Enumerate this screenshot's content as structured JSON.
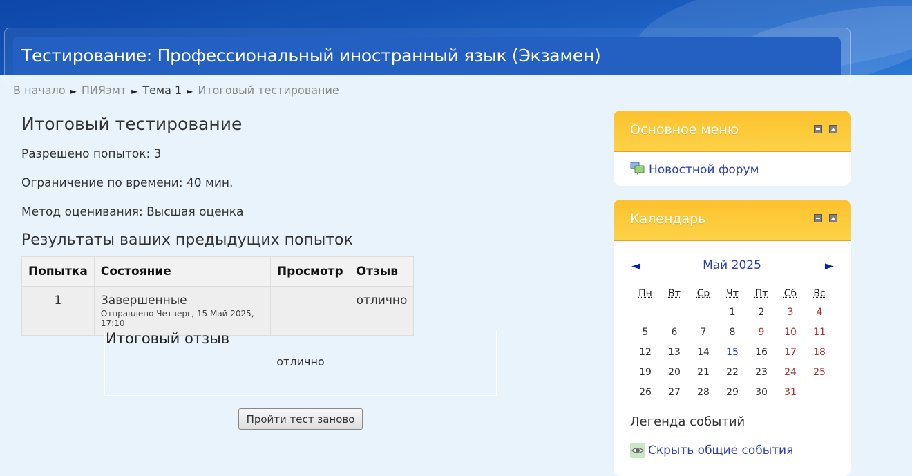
{
  "header": {
    "title": "Тестирование: Профессиональный иностранный язык (Экзамен)"
  },
  "breadcrumb": {
    "items": [
      "В начало",
      "ПИЯэмт",
      "Тема 1",
      "Итоговый тестирование"
    ]
  },
  "quiz": {
    "title": "Итоговый тестирование",
    "attempts_allowed": "Разрешено попыток: 3",
    "time_limit": "Ограничение по времени: 40 мин.",
    "grading_method": "Метод оценивания: Высшая оценка"
  },
  "results": {
    "heading": "Результаты ваших предыдущих попыток",
    "columns": [
      "Попытка",
      "Состояние",
      "Просмотр",
      "Отзыв"
    ],
    "rows": [
      {
        "attempt": "1",
        "state": "Завершенные",
        "state_detail": "Отправлено Четверг, 15 Май 2025, 17:10",
        "review": "",
        "feedback": "отлично"
      }
    ]
  },
  "overall_feedback": {
    "title": "Итоговый отзыв",
    "text": "отлично"
  },
  "retry_button_label": "Пройти тест заново",
  "main_menu": {
    "title": "Основное меню",
    "forum_link": "Новостной форум"
  },
  "calendar": {
    "title": "Календарь",
    "prev": "◄",
    "next": "►",
    "month": "Май 2025",
    "weekdays": [
      "Пн",
      "Вт",
      "Ср",
      "Чт",
      "Пт",
      "Сб",
      "Вс"
    ],
    "weeks": [
      [
        "",
        "",
        "",
        "1",
        "2",
        "3",
        "4"
      ],
      [
        "5",
        "6",
        "7",
        "8",
        "9",
        "10",
        "11"
      ],
      [
        "12",
        "13",
        "14",
        "15",
        "16",
        "17",
        "18"
      ],
      [
        "19",
        "20",
        "21",
        "22",
        "23",
        "24",
        "25"
      ],
      [
        "26",
        "27",
        "28",
        "29",
        "30",
        "31",
        ""
      ]
    ],
    "today": "15",
    "legend_title": "Легенда событий",
    "legend_link": "Скрыть общие события"
  },
  "colors": {
    "banner": "#1656b8",
    "block_header": "#fdc22d",
    "link": "#2c3fb5",
    "weekend": "#a83232",
    "page_bg": "#e8f3fc"
  }
}
